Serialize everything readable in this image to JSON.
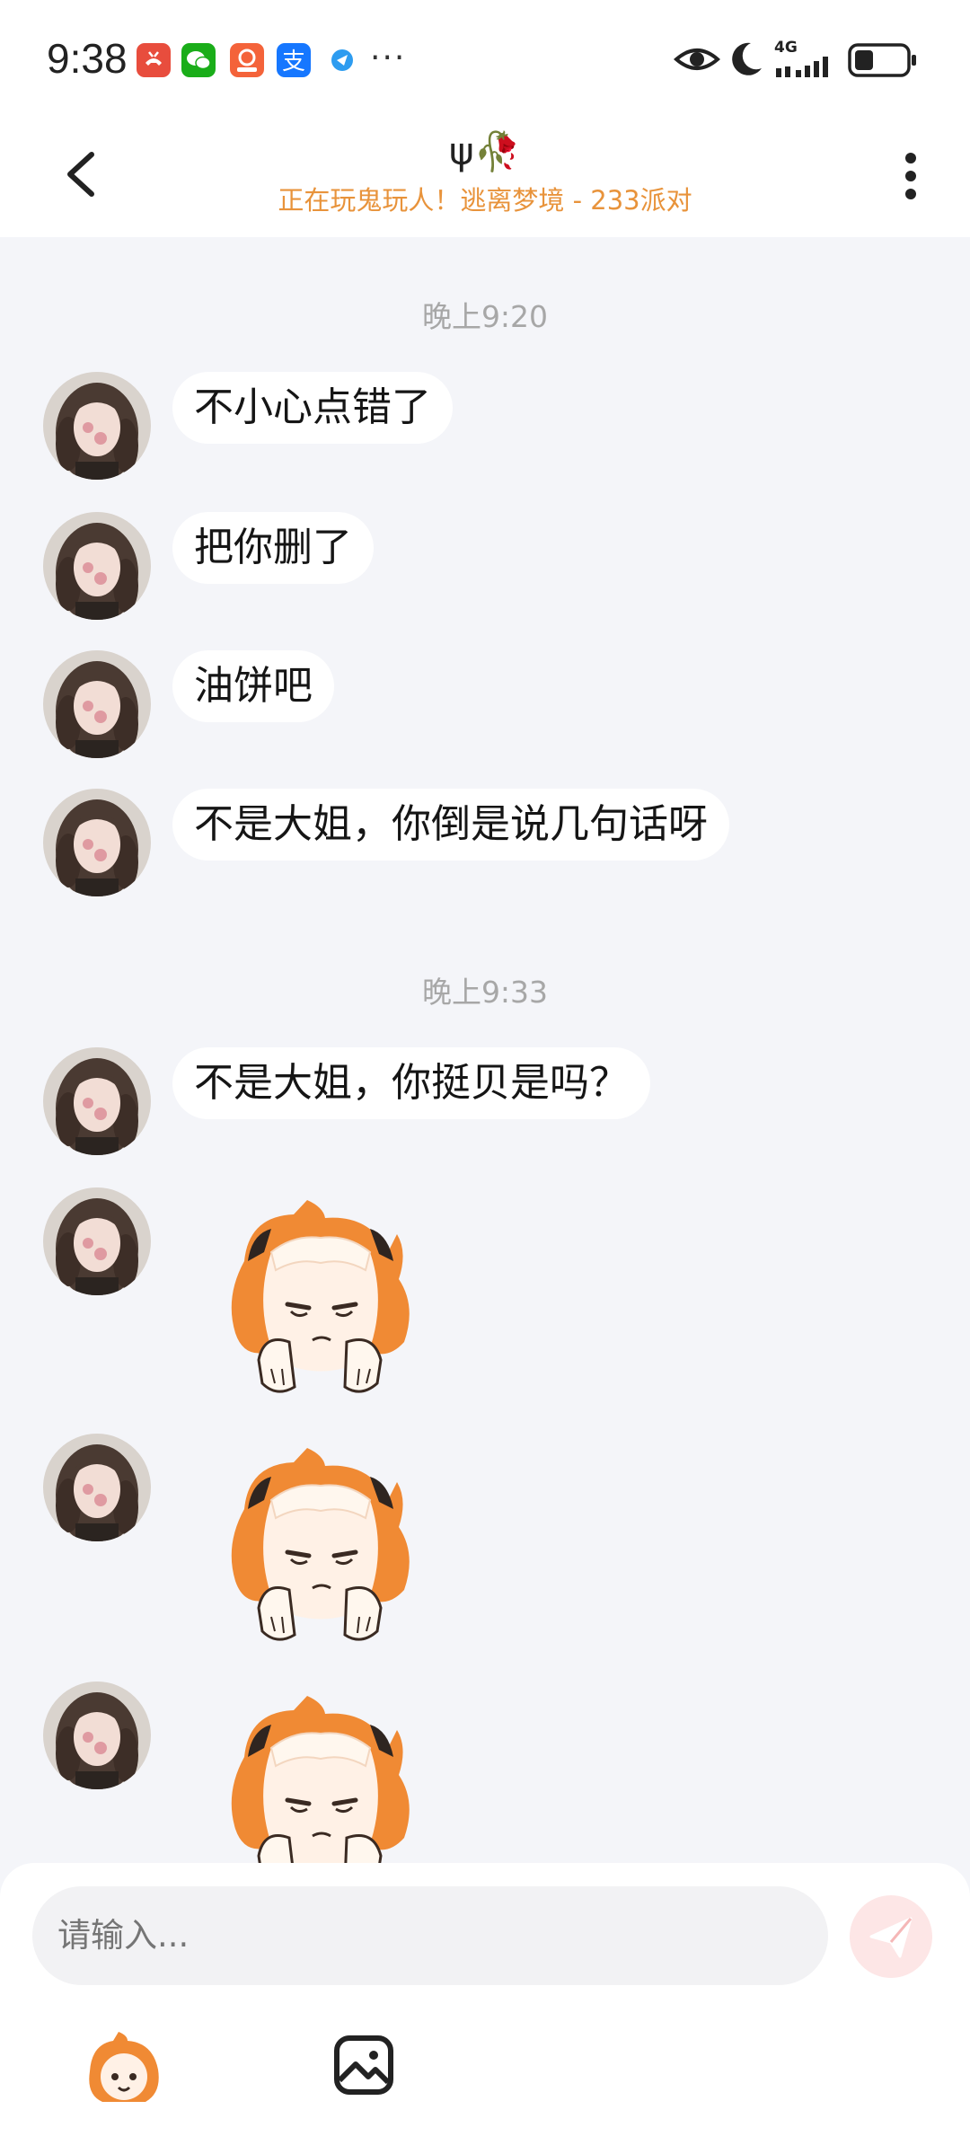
{
  "status_bar": {
    "time": "9:38",
    "notification_icons": [
      "missed-call-icon",
      "wechat-icon",
      "app-icon",
      "alipay-icon",
      "browser-icon"
    ],
    "more_dots": "···",
    "network": "4G",
    "system_icons": [
      "eye-icon",
      "moon-icon",
      "signal-icon",
      "battery-icon"
    ]
  },
  "header": {
    "title": "ψ🥀",
    "subtitle": "正在玩鬼玩人！逃离梦境 - 233派对",
    "subtitle_color": "#e8933b"
  },
  "chat": {
    "timestamps": [
      "晚上9:20",
      "晚上9:33"
    ],
    "messages": [
      {
        "type": "text",
        "text": "不小心点错了"
      },
      {
        "type": "text",
        "text": "把你删了"
      },
      {
        "type": "text",
        "text": "油饼吧"
      },
      {
        "type": "text",
        "text": "不是大姐，你倒是说几句话呀"
      },
      {
        "type": "text",
        "text": "不是大姐，你挺贝是吗？"
      },
      {
        "type": "sticker",
        "sticker": "unimpressed-character-sticker"
      },
      {
        "type": "sticker",
        "sticker": "unimpressed-character-sticker"
      },
      {
        "type": "sticker",
        "sticker": "unimpressed-character-sticker"
      }
    ]
  },
  "composer": {
    "placeholder": "请输入...",
    "send_icon": "send-icon",
    "send_color": "#f5b7b7",
    "toolbar_icons": [
      "emoji-sticker-icon",
      "image-icon"
    ]
  },
  "colors": {
    "background": "#f4f5f9",
    "bubble": "#ffffff",
    "accent": "#e8933b"
  }
}
